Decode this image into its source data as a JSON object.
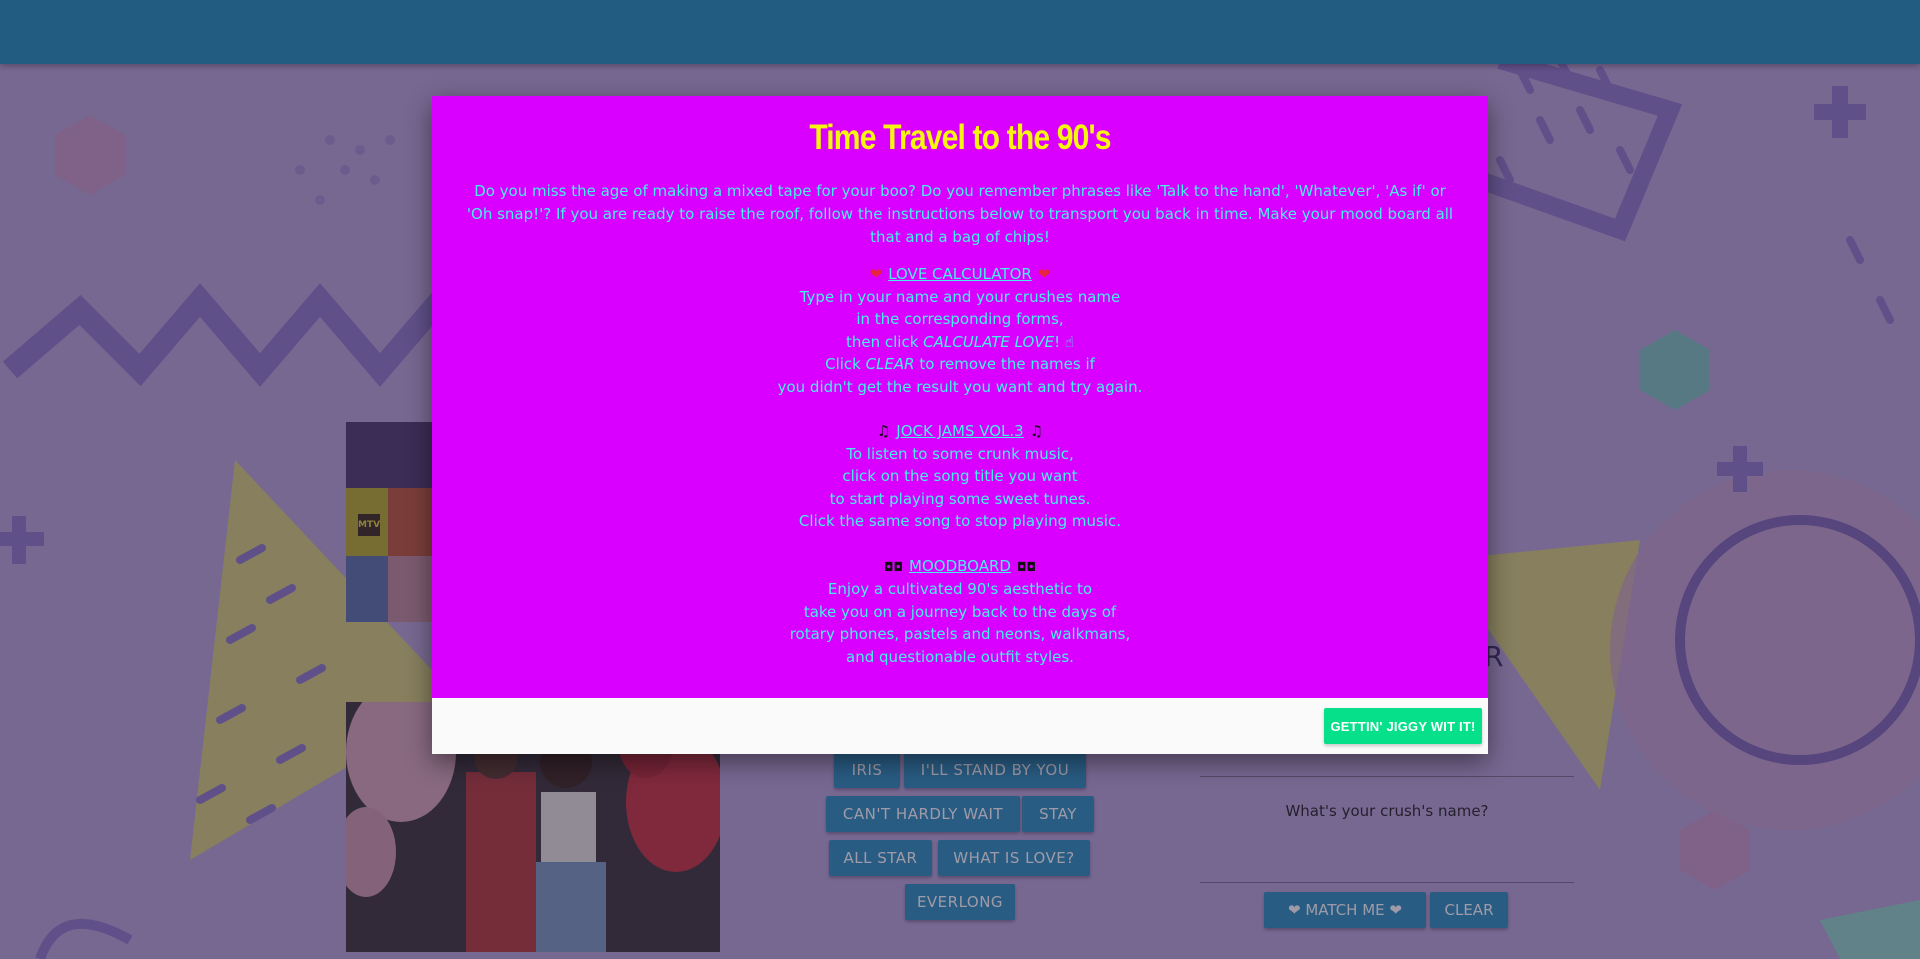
{
  "modal": {
    "title": "Time Travel to the 90's",
    "intro": "Do you miss the age of making a mixed tape for your boo? Do you remember phrases like 'Talk to the hand', 'Whatever', 'As if' or 'Oh snap!'? If you are ready to raise the roof, follow the instructions below to transport you back in time. Make your mood board all that and a bag of chips!",
    "love_calculator": {
      "heading": "LOVE CALCULATOR",
      "icon": "heart-icon",
      "line1": "Type in your name and your crushes name",
      "line2": "in the corresponding forms,",
      "line3_prefix": "then click ",
      "line3_action": "CALCULATE LOVE",
      "line3_suffix": "! ☝",
      "line4_prefix": "Click ",
      "line4_action": "CLEAR",
      "line4_suffix": " to remove the names if",
      "line5": "you didn't get the result you want and try again."
    },
    "jock_jams": {
      "heading": "JOCK JAMS VOL.3",
      "icon": "music-note-icon",
      "line1": "To listen to some crunk music,",
      "line2": "click on the song title you want",
      "line3": "to start playing some sweet tunes.",
      "line4": "Click the same song to stop playing music."
    },
    "moodboard": {
      "heading": "MOODBOARD",
      "icon": "sunglasses-icon",
      "line1": "Enjoy a cultivated 90's aesthetic to",
      "line2": "take you on a journey back to the days of",
      "line3": "rotary phones, pastels and neons, walkmans,",
      "line4": "and questionable outfit styles."
    },
    "footer_button": "GETTIN' JIGGY WIT IT!"
  },
  "songs": {
    "iris": "IRIS",
    "ill_stand_by_you": "I'LL STAND BY YOU",
    "cant_hardly_wait": "CAN'T HARDLY WAIT",
    "stay": "STAY",
    "all_star": "ALL STAR",
    "what_is_love": "WHAT IS LOVE?",
    "everlong": "EVERLONG"
  },
  "calculator": {
    "heading_partial": "R",
    "crush_label": "What's your crush's name?",
    "match_button": "❤ MATCH ME ❤",
    "clear_button": "CLEAR"
  },
  "moodboard_thumb": {
    "badge": "MTV"
  },
  "colors": {
    "navbar": "#1e8fb8",
    "modal_bg": "#d900ff",
    "title": "#f5f50f",
    "text": "#44f0ee",
    "footer_button": "#06e08a",
    "song_button": "#2a8fbd"
  }
}
